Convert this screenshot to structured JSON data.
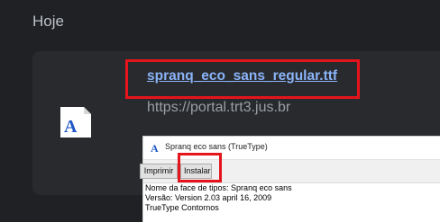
{
  "section": {
    "title": "Hoje"
  },
  "download": {
    "file_name": "spranq_eco_sans_regular.ttf",
    "url": "https://portal.trt3.jus.br",
    "file_icon": "font-file-icon"
  },
  "font_window": {
    "title": "Spranq eco sans (TrueType)",
    "app_icon": "font-app-icon",
    "buttons": {
      "print": "Imprimir",
      "install": "Instalar"
    },
    "info": [
      "Nome da face de tipos: Spranq eco sans",
      "Versão: Version 2.03 april 16, 2009",
      "TrueType Contornos"
    ]
  },
  "colors": {
    "background": "#202124",
    "card": "#292a2d",
    "link": "#8ab4f8",
    "highlight": "#e5141c"
  }
}
